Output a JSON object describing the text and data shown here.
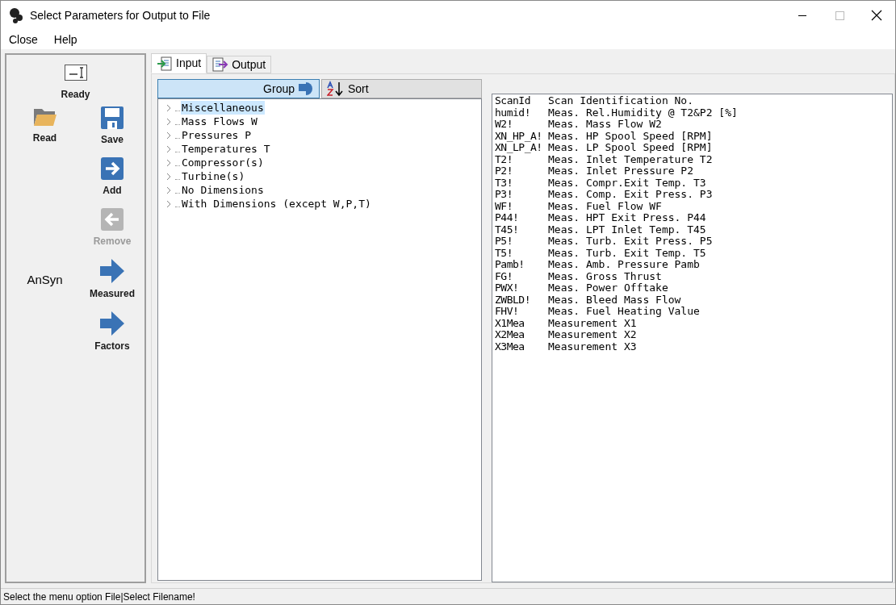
{
  "window": {
    "title": "Select Parameters for Output to File"
  },
  "menu": [
    "Close",
    "Help"
  ],
  "toolbar": {
    "top": {
      "kind": "text",
      "label": "Ready",
      "disabled": false
    },
    "left": [
      {
        "kind": "open",
        "label": "Read",
        "disabled": false
      }
    ],
    "right": [
      {
        "kind": "save",
        "label": "Save",
        "disabled": false
      },
      {
        "kind": "add",
        "label": "Add",
        "disabled": false
      },
      {
        "kind": "remove",
        "label": "Remove",
        "disabled": true
      },
      {
        "kind": "arrow",
        "label": "Measured",
        "disabled": false
      },
      {
        "kind": "arrow",
        "label": "Factors",
        "disabled": false
      }
    ],
    "side_label": "AnSyn"
  },
  "tabs": [
    {
      "kind": "input",
      "label": "Input",
      "selected": true
    },
    {
      "kind": "output",
      "label": "Output",
      "selected": false
    }
  ],
  "view_buttons": [
    {
      "kind": "group",
      "label": "Group",
      "selected": true
    },
    {
      "kind": "sort",
      "label": "Sort",
      "selected": false
    }
  ],
  "tree": [
    {
      "label": "Miscellaneous",
      "selected": true
    },
    {
      "label": "Mass Flows W",
      "selected": false
    },
    {
      "label": "Pressures P",
      "selected": false
    },
    {
      "label": "Temperatures T",
      "selected": false
    },
    {
      "label": "Compressor(s)",
      "selected": false
    },
    {
      "label": "Turbine(s)",
      "selected": false
    },
    {
      "label": "No Dimensions",
      "selected": false
    },
    {
      "label": "With Dimensions (except W,P,T)",
      "selected": false
    }
  ],
  "parameters": [
    {
      "id": "ScanId",
      "description": "Scan Identification No."
    },
    {
      "id": "humid!",
      "description": "Meas. Rel.Humidity @ T2&P2 [%]"
    },
    {
      "id": "W2!",
      "description": "Meas. Mass Flow W2"
    },
    {
      "id": "XN_HP_A!",
      "description": "Meas. HP Spool Speed [RPM]"
    },
    {
      "id": "XN_LP_A!",
      "description": "Meas. LP Spool Speed [RPM]"
    },
    {
      "id": "T2!",
      "description": "Meas. Inlet Temperature T2"
    },
    {
      "id": "P2!",
      "description": "Meas. Inlet Pressure P2"
    },
    {
      "id": "T3!",
      "description": "Meas. Compr.Exit Temp. T3"
    },
    {
      "id": "P3!",
      "description": "Meas. Comp. Exit Press. P3"
    },
    {
      "id": "WF!",
      "description": "Meas. Fuel Flow WF"
    },
    {
      "id": "P44!",
      "description": "Meas. HPT Exit Press. P44"
    },
    {
      "id": "T45!",
      "description": "Meas. LPT Inlet Temp. T45"
    },
    {
      "id": "P5!",
      "description": "Meas. Turb. Exit Press. P5"
    },
    {
      "id": "T5!",
      "description": "Meas. Turb. Exit Temp. T5"
    },
    {
      "id": "Pamb!",
      "description": "Meas. Amb. Pressure Pamb"
    },
    {
      "id": "FG!",
      "description": "Meas. Gross Thrust"
    },
    {
      "id": "PWX!",
      "description": "Meas. Power Offtake"
    },
    {
      "id": "ZWBLD!",
      "description": "Meas. Bleed Mass Flow"
    },
    {
      "id": "FHV!",
      "description": "Meas. Fuel Heating Value"
    },
    {
      "id": "X1Mea",
      "description": "Measurement X1"
    },
    {
      "id": "X2Mea",
      "description": "Measurement X2"
    },
    {
      "id": "X3Mea",
      "description": "Measurement X3"
    }
  ],
  "status_bar": "Select the menu option File|Select Filename!"
}
